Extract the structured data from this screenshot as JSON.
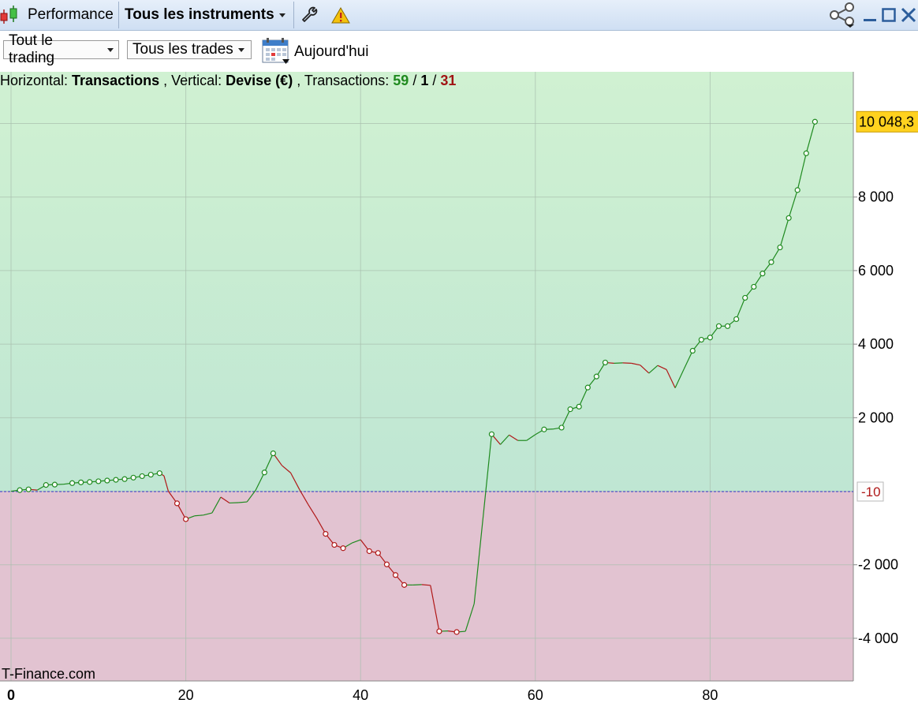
{
  "titlebar": {
    "app_icon": "candlestick-icon",
    "tab_performance": "Performance",
    "instrument_selector": "Tous les instruments",
    "settings_icon": "wrench-icon",
    "warning_icon": "warning-icon",
    "share_icon": "share-icon",
    "minimize_icon": "minimize-icon",
    "maximize_icon": "maximize-icon",
    "close_icon": "close-icon"
  },
  "toolbar": {
    "trading_filter": "Tout le trading",
    "trades_filter": "Tous les trades",
    "calendar_icon": "calendar-icon",
    "date_label": "Aujourd'hui"
  },
  "header": {
    "prefix": "Horizontal: ",
    "h_value": "Transactions",
    "mid": ", Vertical: ",
    "v_value": "Devise (€)",
    "trans_label": ", Transactions: ",
    "wins": "59",
    "slash1": " / ",
    "even": "1",
    "slash2": " / ",
    "losses": "31"
  },
  "watermark": "T-Finance.com",
  "colors": {
    "gain_line": "#1f8a1f",
    "loss_line": "#b01818",
    "positive_zone": "#cdf0cf",
    "negative_zone": "#e2c3d1",
    "last_value_badge": "#ffd21f",
    "zero_line": "#3a3ad0"
  },
  "chart_data": {
    "type": "line",
    "xlabel": "",
    "ylabel": "",
    "xlim": [
      0,
      96
    ],
    "ylim": [
      -5200,
      11600
    ],
    "x_ticks": [
      0,
      20,
      40,
      60,
      80
    ],
    "x_tick_labels": [
      "0",
      "20",
      "40",
      "60",
      "80"
    ],
    "y_ticks": [
      8000,
      6000,
      4000,
      2000,
      -2000,
      -4000
    ],
    "y_tick_labels": [
      "8 000",
      "6 000",
      "4 000",
      "2 000",
      "-2 000",
      "-4 000"
    ],
    "reference_value": -10,
    "reference_label": "-10",
    "last_value": 10048.3,
    "last_value_label": "10 048,3",
    "grid": true,
    "points": [
      [
        0,
        0
      ],
      [
        1,
        30
      ],
      [
        2,
        50
      ],
      [
        3,
        30
      ],
      [
        4,
        170
      ],
      [
        5,
        180
      ],
      [
        6,
        190
      ],
      [
        7,
        220
      ],
      [
        8,
        240
      ],
      [
        9,
        250
      ],
      [
        10,
        270
      ],
      [
        11,
        290
      ],
      [
        12,
        310
      ],
      [
        13,
        330
      ],
      [
        14,
        370
      ],
      [
        15,
        410
      ],
      [
        16,
        450
      ],
      [
        17,
        490
      ],
      [
        17.5,
        420
      ],
      [
        18,
        0
      ],
      [
        19,
        -330
      ],
      [
        20,
        -760
      ],
      [
        21,
        -670
      ],
      [
        22,
        -650
      ],
      [
        23,
        -590
      ],
      [
        24,
        -160
      ],
      [
        25,
        -320
      ],
      [
        26,
        -310
      ],
      [
        27,
        -290
      ],
      [
        28,
        30
      ],
      [
        29,
        510
      ],
      [
        30,
        1030
      ],
      [
        31,
        700
      ],
      [
        32,
        500
      ],
      [
        33,
        50
      ],
      [
        34,
        -360
      ],
      [
        35,
        -740
      ],
      [
        36,
        -1160
      ],
      [
        37,
        -1460
      ],
      [
        38,
        -1550
      ],
      [
        39,
        -1410
      ],
      [
        40,
        -1320
      ],
      [
        41,
        -1630
      ],
      [
        42,
        -1680
      ],
      [
        43,
        -1990
      ],
      [
        44,
        -2280
      ],
      [
        45,
        -2550
      ],
      [
        46,
        -2550
      ],
      [
        47,
        -2540
      ],
      [
        48,
        -2560
      ],
      [
        49,
        -3810
      ],
      [
        50,
        -3800
      ],
      [
        51,
        -3830
      ],
      [
        52,
        -3810
      ],
      [
        53,
        -3060
      ],
      [
        55,
        1550
      ],
      [
        56,
        1270
      ],
      [
        57,
        1530
      ],
      [
        58,
        1380
      ],
      [
        59,
        1380
      ],
      [
        60,
        1540
      ],
      [
        61,
        1680
      ],
      [
        62,
        1690
      ],
      [
        63,
        1730
      ],
      [
        64,
        2230
      ],
      [
        65,
        2300
      ],
      [
        66,
        2820
      ],
      [
        67,
        3120
      ],
      [
        68,
        3500
      ],
      [
        69,
        3480
      ],
      [
        70,
        3490
      ],
      [
        71,
        3480
      ],
      [
        72,
        3430
      ],
      [
        73,
        3210
      ],
      [
        74,
        3420
      ],
      [
        75,
        3310
      ],
      [
        76,
        2810
      ],
      [
        77,
        3320
      ],
      [
        78,
        3820
      ],
      [
        79,
        4120
      ],
      [
        80,
        4180
      ],
      [
        81,
        4490
      ],
      [
        82,
        4490
      ],
      [
        83,
        4680
      ],
      [
        84,
        5260
      ],
      [
        85,
        5560
      ],
      [
        86,
        5920
      ],
      [
        87,
        6230
      ],
      [
        88,
        6630
      ],
      [
        89,
        7430
      ],
      [
        90,
        8190
      ],
      [
        91,
        9190
      ],
      [
        92,
        10048.3
      ]
    ],
    "marked_points_x": [
      1,
      2,
      4,
      5,
      7,
      8,
      9,
      10,
      11,
      12,
      13,
      14,
      15,
      16,
      17,
      19,
      20,
      29,
      30,
      36,
      37,
      38,
      41,
      42,
      43,
      44,
      45,
      49,
      51,
      55,
      61,
      63,
      64,
      65,
      66,
      67,
      68,
      78,
      79,
      80,
      81,
      82,
      83,
      84,
      85,
      86,
      87,
      88,
      89,
      90,
      91,
      92
    ]
  }
}
